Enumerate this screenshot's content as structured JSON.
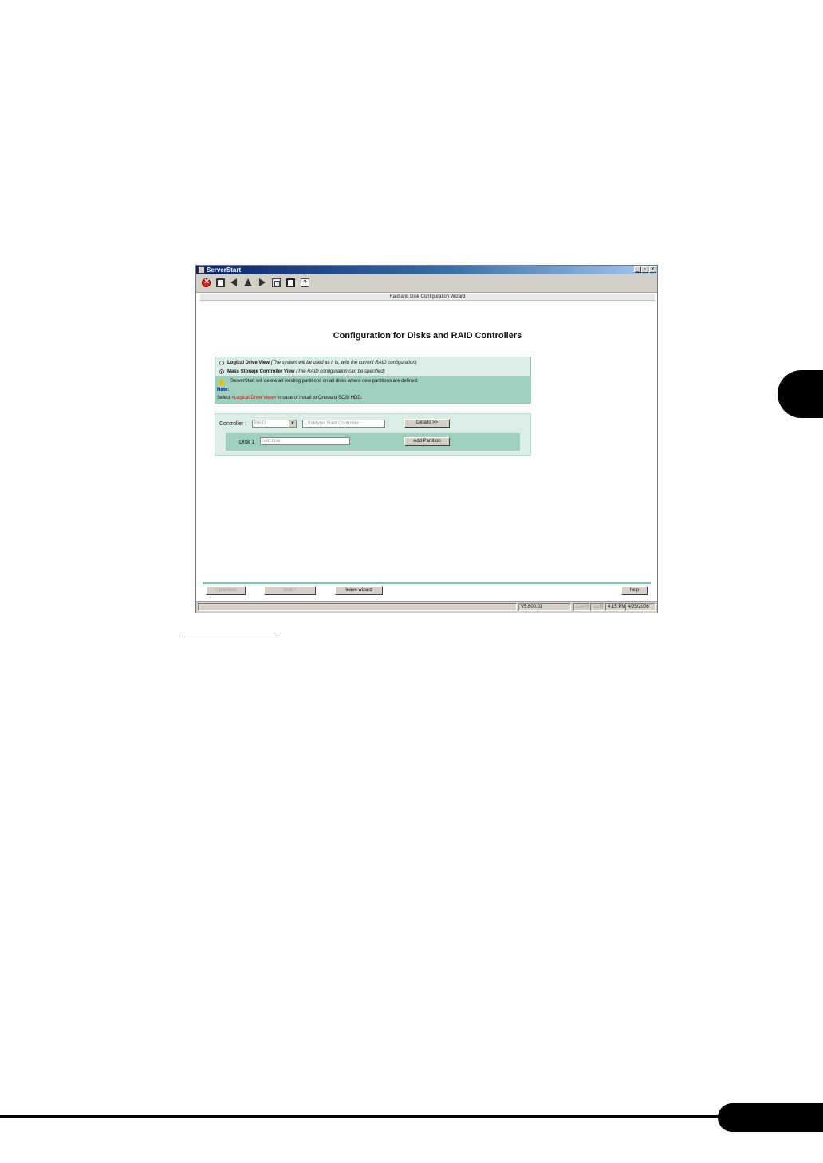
{
  "window": {
    "title": "ServerStart",
    "controls": {
      "minimize": "_",
      "maximize": "▫",
      "close": "x"
    }
  },
  "toolbar": {
    "icons": [
      "stop-icon",
      "home-icon",
      "back-icon",
      "up-icon",
      "forward-icon",
      "document-icon",
      "page-icon",
      "help-icon"
    ]
  },
  "wizard": {
    "bar_title": "Raid and Disk Configuration Wizard",
    "heading": "Configuration for Disks and RAID Controllers"
  },
  "options": {
    "logical": {
      "label": "Logical Drive View",
      "description": "(The system will be used as it is, with the current RAID configuration)",
      "selected": false
    },
    "mass": {
      "label": "Mass Storage Controller View",
      "description": "(The RAID configuration can be specified)",
      "selected": true
    }
  },
  "warning": {
    "text": "ServerStart will delete all existing partitions on all disks where new partitions are defined."
  },
  "note": {
    "label": "Note:",
    "prefix": "Select",
    "highlight": "«Logical Drive View»",
    "suffix": "in case of install to Onboard SCSI HDD."
  },
  "controller": {
    "label": "Controller :",
    "type_value": "RAID",
    "name_value": "LSI/Mylex Raid Controller",
    "details_button": "Details >>"
  },
  "disk": {
    "label": "Disk 1",
    "placeholder": "raid disk",
    "add_button": "Add Partition"
  },
  "nav": {
    "previous": "< previous",
    "next": "next >",
    "leave": "leave wizard",
    "help": "help"
  },
  "status": {
    "version": "V5.600.03",
    "caps": "CAPS",
    "num": "NUM",
    "time": "4:15 PM",
    "date": "4/25/2006"
  },
  "colors": {
    "panel_dark": "#9fd0bd",
    "panel_light": "#dbeee6",
    "accent_line": "#7cc3b0",
    "note_highlight": "#e00000"
  }
}
